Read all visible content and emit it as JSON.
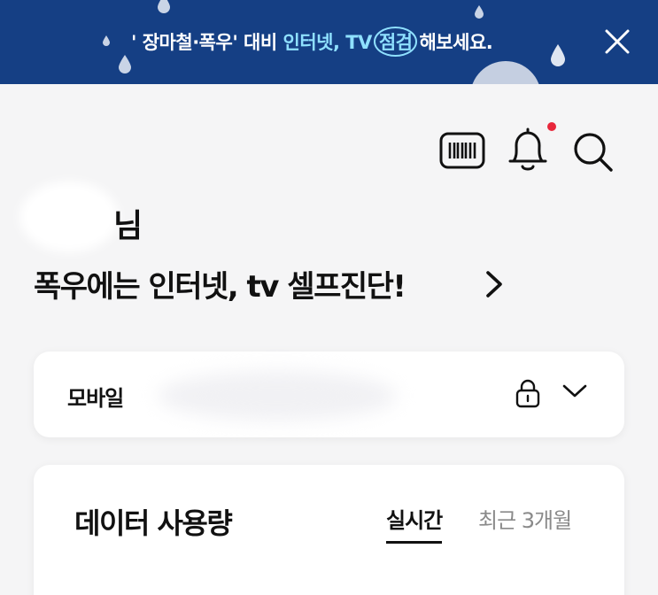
{
  "banner": {
    "text_prefix": "' 장마철·폭우' 대비 ",
    "text_highlight": "인터넷, TV",
    "text_circled": "점검",
    "text_suffix": "해보세요.",
    "background_color": "#153f84",
    "highlight_color": "#8fe0ff",
    "close_icon": "close-icon"
  },
  "header_icons": {
    "barcode_icon": "barcode-icon",
    "notification_icon": "bell-icon",
    "search_icon": "search-icon",
    "notification_dot_color": "#e8273b"
  },
  "greeting": {
    "suffix": "님",
    "headline": "폭우에는 인터넷, tv 셀프진단!",
    "headline_icon": "chevron-right-icon"
  },
  "mobile_card": {
    "label": "모바일",
    "lock_icon": "lock-icon",
    "expand_icon": "chevron-down-icon"
  },
  "data_card": {
    "title": "데이터 사용량",
    "tabs": [
      {
        "label": "실시간",
        "active": true
      },
      {
        "label": "최근 3개월",
        "active": false
      }
    ]
  }
}
